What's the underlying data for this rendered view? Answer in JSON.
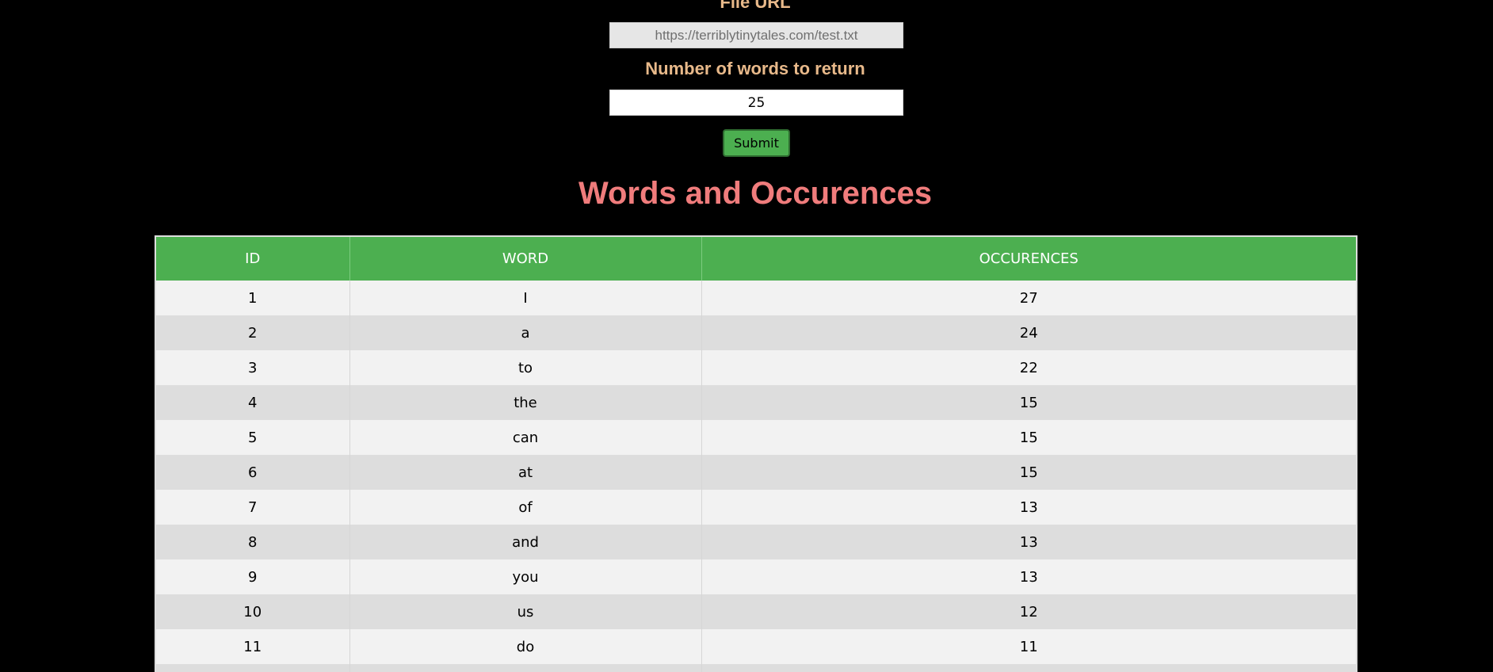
{
  "form": {
    "url_label": "File URL",
    "url_value": "https://terriblytinytales.com/test.txt",
    "count_label": "Number of words to return",
    "count_value": "25",
    "submit_label": "Submit"
  },
  "heading": "Words and Occurences",
  "table": {
    "headers": [
      "ID",
      "WORD",
      "OCCURENCES"
    ],
    "rows": [
      {
        "id": "1",
        "word": "I",
        "occurences": "27"
      },
      {
        "id": "2",
        "word": "a",
        "occurences": "24"
      },
      {
        "id": "3",
        "word": "to",
        "occurences": "22"
      },
      {
        "id": "4",
        "word": "the",
        "occurences": "15"
      },
      {
        "id": "5",
        "word": "can",
        "occurences": "15"
      },
      {
        "id": "6",
        "word": "at",
        "occurences": "15"
      },
      {
        "id": "7",
        "word": "of",
        "occurences": "13"
      },
      {
        "id": "8",
        "word": "and",
        "occurences": "13"
      },
      {
        "id": "9",
        "word": "you",
        "occurences": "13"
      },
      {
        "id": "10",
        "word": "us",
        "occurences": "12"
      },
      {
        "id": "11",
        "word": "do",
        "occurences": "11"
      },
      {
        "id": "",
        "word": "",
        "occurences": ""
      }
    ]
  },
  "colors": {
    "label": "#e8b98a",
    "heading": "#f07c7c",
    "table_header": "#4caf50",
    "submit_button": "#4caf50",
    "row_light": "#f2f2f2",
    "row_dark": "#dddddd"
  }
}
